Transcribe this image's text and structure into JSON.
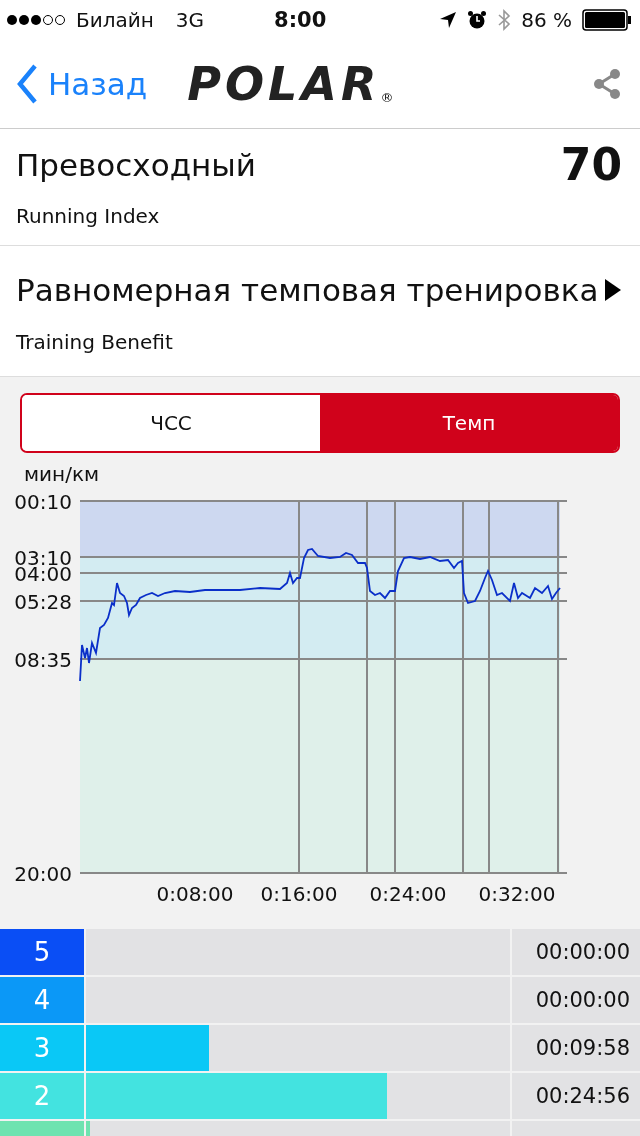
{
  "status_bar": {
    "carrier": "Билайн",
    "network": "3G",
    "time": "8:00",
    "battery": "86 %"
  },
  "nav": {
    "back": "Назад",
    "logo": "POLAR",
    "logo_mark": "®"
  },
  "running_index": {
    "title": "Превосходный",
    "value": "70",
    "label": "Running Index"
  },
  "training_benefit": {
    "title": "Равномерная темповая тренировка",
    "label": "Training Benefit"
  },
  "tabs": [
    {
      "label": "ЧСС",
      "selected": false
    },
    {
      "label": "Темп",
      "selected": true
    }
  ],
  "chart": {
    "y_unit": "мин/км",
    "y_ticks": [
      "00:10",
      "03:10",
      "04:00",
      "05:28",
      "08:35",
      "20:00"
    ],
    "x_ticks": [
      "0:08:00",
      "0:16:00",
      "0:24:00",
      "0:32:00"
    ]
  },
  "zones": [
    {
      "label": "5",
      "color": "#0a4ef5",
      "time": "00:00:00"
    },
    {
      "label": "4",
      "color": "#0b98f7",
      "time": "00:00:00"
    },
    {
      "label": "3",
      "color": "#0ac8f6",
      "level": 0.29,
      "time": "00:09:58"
    },
    {
      "label": "2",
      "color": "#43e3e0",
      "level": 0.71,
      "time": "00:24:56"
    },
    {
      "color": "#6ee3b0",
      "level": 0.01
    }
  ]
}
